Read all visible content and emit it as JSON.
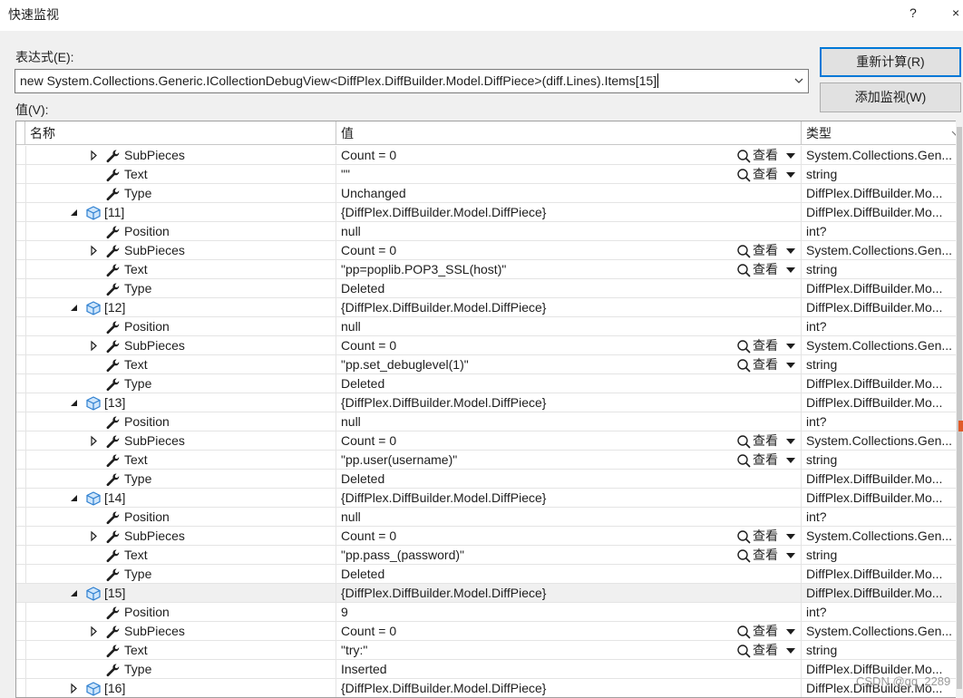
{
  "window": {
    "title": "快速监视",
    "help": "?",
    "close": "×"
  },
  "expression": {
    "label": "表达式(E):",
    "value": "new System.Collections.Generic.ICollectionDebugView<DiffPlex.DiffBuilder.Model.DiffPiece>(diff.Lines).Items[15]"
  },
  "buttons": {
    "recalculate": "重新计算(R)",
    "add_watch": "添加监视(W)"
  },
  "value_label": "值(V):",
  "grid": {
    "headers": {
      "name": "名称",
      "value": "值",
      "type": "类型"
    },
    "view_label": "查看",
    "rows": [
      {
        "level": 2,
        "expander": "collapsed",
        "icon": "wrench-icon",
        "name": "SubPieces",
        "value": "Count = 0",
        "type": "System.Collections.Gen...",
        "view": true
      },
      {
        "level": 2,
        "expander": "none",
        "icon": "wrench-icon",
        "name": "Text",
        "value": "\"\"",
        "type": "string",
        "view": true
      },
      {
        "level": 2,
        "expander": "none",
        "icon": "wrench-icon",
        "name": "Type",
        "value": "Unchanged",
        "type": "DiffPlex.DiffBuilder.Mo...",
        "view": false
      },
      {
        "level": 1,
        "expander": "expanded",
        "icon": "object-icon",
        "name": "[11]",
        "value": "{DiffPlex.DiffBuilder.Model.DiffPiece}",
        "type": "DiffPlex.DiffBuilder.Mo...",
        "view": false
      },
      {
        "level": 2,
        "expander": "none",
        "icon": "wrench-icon",
        "name": "Position",
        "value": "null",
        "type": "int?",
        "view": false
      },
      {
        "level": 2,
        "expander": "collapsed",
        "icon": "wrench-icon",
        "name": "SubPieces",
        "value": "Count = 0",
        "type": "System.Collections.Gen...",
        "view": true
      },
      {
        "level": 2,
        "expander": "none",
        "icon": "wrench-icon",
        "name": "Text",
        "value": "\"pp=poplib.POP3_SSL(host)\"",
        "type": "string",
        "view": true
      },
      {
        "level": 2,
        "expander": "none",
        "icon": "wrench-icon",
        "name": "Type",
        "value": "Deleted",
        "type": "DiffPlex.DiffBuilder.Mo...",
        "view": false
      },
      {
        "level": 1,
        "expander": "expanded",
        "icon": "object-icon",
        "name": "[12]",
        "value": "{DiffPlex.DiffBuilder.Model.DiffPiece}",
        "type": "DiffPlex.DiffBuilder.Mo...",
        "view": false
      },
      {
        "level": 2,
        "expander": "none",
        "icon": "wrench-icon",
        "name": "Position",
        "value": "null",
        "type": "int?",
        "view": false
      },
      {
        "level": 2,
        "expander": "collapsed",
        "icon": "wrench-icon",
        "name": "SubPieces",
        "value": "Count = 0",
        "type": "System.Collections.Gen...",
        "view": true
      },
      {
        "level": 2,
        "expander": "none",
        "icon": "wrench-icon",
        "name": "Text",
        "value": "\"pp.set_debuglevel(1)\"",
        "type": "string",
        "view": true
      },
      {
        "level": 2,
        "expander": "none",
        "icon": "wrench-icon",
        "name": "Type",
        "value": "Deleted",
        "type": "DiffPlex.DiffBuilder.Mo...",
        "view": false
      },
      {
        "level": 1,
        "expander": "expanded",
        "icon": "object-icon",
        "name": "[13]",
        "value": "{DiffPlex.DiffBuilder.Model.DiffPiece}",
        "type": "DiffPlex.DiffBuilder.Mo...",
        "view": false
      },
      {
        "level": 2,
        "expander": "none",
        "icon": "wrench-icon",
        "name": "Position",
        "value": "null",
        "type": "int?",
        "view": false
      },
      {
        "level": 2,
        "expander": "collapsed",
        "icon": "wrench-icon",
        "name": "SubPieces",
        "value": "Count = 0",
        "type": "System.Collections.Gen...",
        "view": true
      },
      {
        "level": 2,
        "expander": "none",
        "icon": "wrench-icon",
        "name": "Text",
        "value": "\"pp.user(username)\"",
        "type": "string",
        "view": true
      },
      {
        "level": 2,
        "expander": "none",
        "icon": "wrench-icon",
        "name": "Type",
        "value": "Deleted",
        "type": "DiffPlex.DiffBuilder.Mo...",
        "view": false
      },
      {
        "level": 1,
        "expander": "expanded",
        "icon": "object-icon",
        "name": "[14]",
        "value": "{DiffPlex.DiffBuilder.Model.DiffPiece}",
        "type": "DiffPlex.DiffBuilder.Mo...",
        "view": false
      },
      {
        "level": 2,
        "expander": "none",
        "icon": "wrench-icon",
        "name": "Position",
        "value": "null",
        "type": "int?",
        "view": false
      },
      {
        "level": 2,
        "expander": "collapsed",
        "icon": "wrench-icon",
        "name": "SubPieces",
        "value": "Count = 0",
        "type": "System.Collections.Gen...",
        "view": true
      },
      {
        "level": 2,
        "expander": "none",
        "icon": "wrench-icon",
        "name": "Text",
        "value": "\"pp.pass_(password)\"",
        "type": "string",
        "view": true
      },
      {
        "level": 2,
        "expander": "none",
        "icon": "wrench-icon",
        "name": "Type",
        "value": "Deleted",
        "type": "DiffPlex.DiffBuilder.Mo...",
        "view": false
      },
      {
        "level": 1,
        "expander": "expanded",
        "icon": "object-icon",
        "name": "[15]",
        "value": "{DiffPlex.DiffBuilder.Model.DiffPiece}",
        "type": "DiffPlex.DiffBuilder.Mo...",
        "view": false,
        "selected": true
      },
      {
        "level": 2,
        "expander": "none",
        "icon": "wrench-icon",
        "name": "Position",
        "value": "9",
        "type": "int?",
        "view": false
      },
      {
        "level": 2,
        "expander": "collapsed",
        "icon": "wrench-icon",
        "name": "SubPieces",
        "value": "Count = 0",
        "type": "System.Collections.Gen...",
        "view": true
      },
      {
        "level": 2,
        "expander": "none",
        "icon": "wrench-icon",
        "name": "Text",
        "value": "\"try:\"",
        "type": "string",
        "view": true
      },
      {
        "level": 2,
        "expander": "none",
        "icon": "wrench-icon",
        "name": "Type",
        "value": "Inserted",
        "type": "DiffPlex.DiffBuilder.Mo...",
        "view": false
      },
      {
        "level": 1,
        "expander": "collapsed",
        "icon": "object-icon",
        "name": "[16]",
        "value": "{DiffPlex.DiffBuilder.Model.DiffPiece}",
        "type": "DiffPlex.DiffBuilder.Mo...",
        "view": false
      }
    ]
  },
  "watermark": "CSDN @qq_2289",
  "colors": {
    "accent": "#0078d7",
    "scroll_marker": "#e05a28"
  }
}
